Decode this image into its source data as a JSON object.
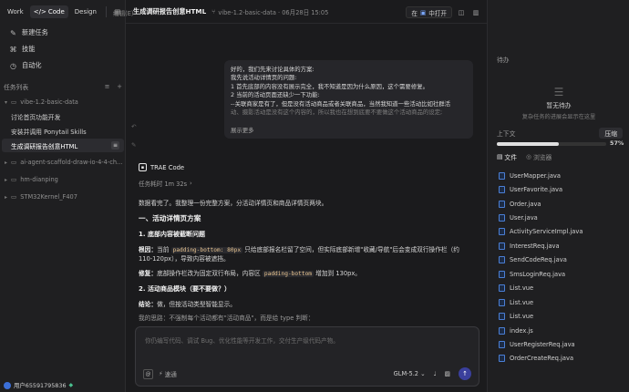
{
  "modes": {
    "work": "Work",
    "code": "Code",
    "design": "Design"
  },
  "editor_menu": "编辑(E)",
  "nav": {
    "new_task": "新建任务",
    "skills": "技能",
    "automation": "自动化"
  },
  "task_list": {
    "title": "任务列表",
    "groups": [
      {
        "label": "vibe-1.2-basic-data",
        "tasks": [
          "讨论首页功能开发",
          "安装并调用 Ponytail Skills",
          "生成调研报告创意HTML"
        ]
      },
      {
        "label": "ai-agent-scaffold-draw-io-4-4-ch..."
      },
      {
        "label": "hm-dianping"
      },
      {
        "label": "STM32Kernel_F407"
      }
    ]
  },
  "user": {
    "name": "用户65591795836"
  },
  "header": {
    "title": "生成调研报告创意HTML",
    "branch": "vibe-1.2-basic-data · 06月28日 15:05",
    "open_in_prefix": "在",
    "open_in": "中打开"
  },
  "bubble": {
    "lines": [
      "好的，我们先来讨论具体的方案:",
      "我先说活动详情页的问题:",
      "1 首先底部的内容没有展示完全，我不知道是因为什么原因，这个需要修复。",
      "2 当前的活动页面还缺少一下功能:",
      "--关联商家是有了，但是没有活动商品或者关联商品，当然我知道一些活动比如社群活",
      "动、摄影活动是没有这个内容的，所以我也在想到底要不要做这个活动商品的设定;"
    ],
    "more": "展示更多"
  },
  "agent": {
    "name": "TRAE Code",
    "elapsed": "任务耗时 1m 32s"
  },
  "content": {
    "intro": "数据看完了。我整理一份完整方案，分活动详情页和商品详情页两块。",
    "h1": "一、活动详情页方案",
    "s1": "1. 底部内容被截断问题",
    "s1_p1_label": "根因：",
    "s1_p1_a": "当前 ",
    "s1_p1_code": "padding-bottom: 80px",
    "s1_p1_b": " 只给底部报名栏留了空间，但实际底部新增\"收藏/导航\"后会变成双行操作栏（约",
    "s1_p1_c": "110-120px），导致内容被遮挡。",
    "s1_p2_label": "修复：",
    "s1_p2_a": "底部操作栏改为固定双行布局，内容区 ",
    "s1_p2_code": "padding-bottom",
    "s1_p2_b": " 增加到 130px。",
    "s2": "2. 活动商品模块（要不要做？）",
    "s2_p1_label": "结论：",
    "s2_p1": "做，但按活动类型智能显示。",
    "s2_p2": "我的思路：不强制每个活动都有\"活动商品\"，而是给 type 判断："
  },
  "composer": {
    "placeholder": "你仍编写代码、调试 Bug、优化性能等开发工作，交付生产级代码产物。",
    "speed": "速通",
    "model": "GLM-5.2"
  },
  "panel": {
    "todo": "待办",
    "empty_title": "暂无待办",
    "empty_desc": "复杂任务的进展会显示在这里",
    "context": "上下文",
    "compress": "压缩",
    "context_pct": "57%",
    "context_fraction": 0.57,
    "tabs": {
      "files": "文件",
      "browser": "浏览器"
    },
    "files": [
      "UserMapper.java",
      "UserFavorite.java",
      "Order.java",
      "User.java",
      "ActivityServiceImpl.java",
      "InterestReq.java",
      "SendCodeReq.java",
      "SmsLoginReq.java",
      "List.vue",
      "List.vue",
      "List.vue",
      "index.js",
      "UserRegisterReq.java",
      "OrderCreateReq.java"
    ]
  }
}
